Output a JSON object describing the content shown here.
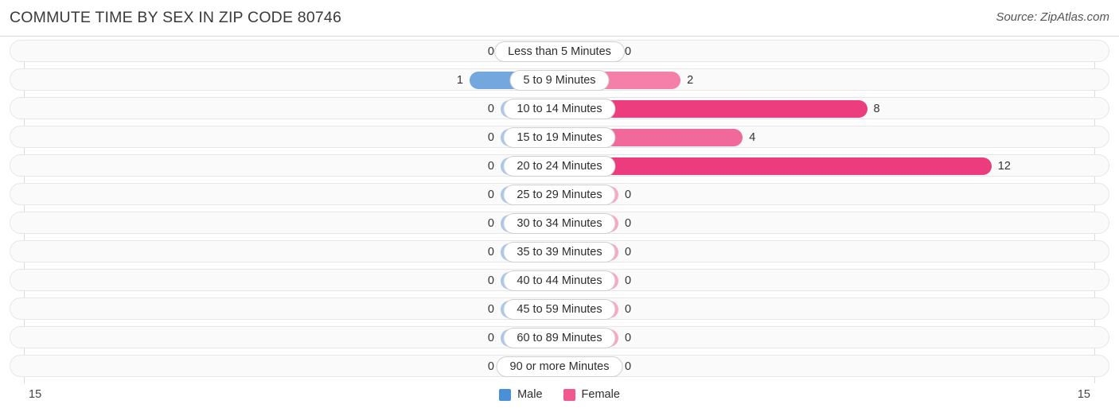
{
  "header": {
    "title": "COMMUTE TIME BY SEX IN ZIP CODE 80746",
    "source": "Source: ZipAtlas.com"
  },
  "legend": {
    "male_label": "Male",
    "female_label": "Female",
    "male_color": "#4a90d9",
    "female_color": "#f2578f"
  },
  "axis": {
    "left_max": "15",
    "right_max": "15"
  },
  "chart_data": {
    "type": "bar",
    "subtype": "diverging-bar",
    "title": "COMMUTE TIME BY SEX IN ZIP CODE 80746",
    "xlabel": "",
    "ylabel": "",
    "xlim": [
      15,
      15
    ],
    "grid": false,
    "legend_position": "bottom-center",
    "categories": [
      "Less than 5 Minutes",
      "5 to 9 Minutes",
      "10 to 14 Minutes",
      "15 to 19 Minutes",
      "20 to 24 Minutes",
      "25 to 29 Minutes",
      "30 to 34 Minutes",
      "35 to 39 Minutes",
      "40 to 44 Minutes",
      "45 to 59 Minutes",
      "60 to 89 Minutes",
      "90 or more Minutes"
    ],
    "series": [
      {
        "name": "Male",
        "direction": "left",
        "color": "#4a90d9",
        "values": [
          0,
          1,
          0,
          0,
          0,
          0,
          0,
          0,
          0,
          0,
          0,
          0
        ]
      },
      {
        "name": "Female",
        "direction": "right",
        "color": "#f2578f",
        "values": [
          0,
          2,
          8,
          4,
          12,
          0,
          0,
          0,
          0,
          0,
          0,
          0
        ]
      }
    ]
  }
}
